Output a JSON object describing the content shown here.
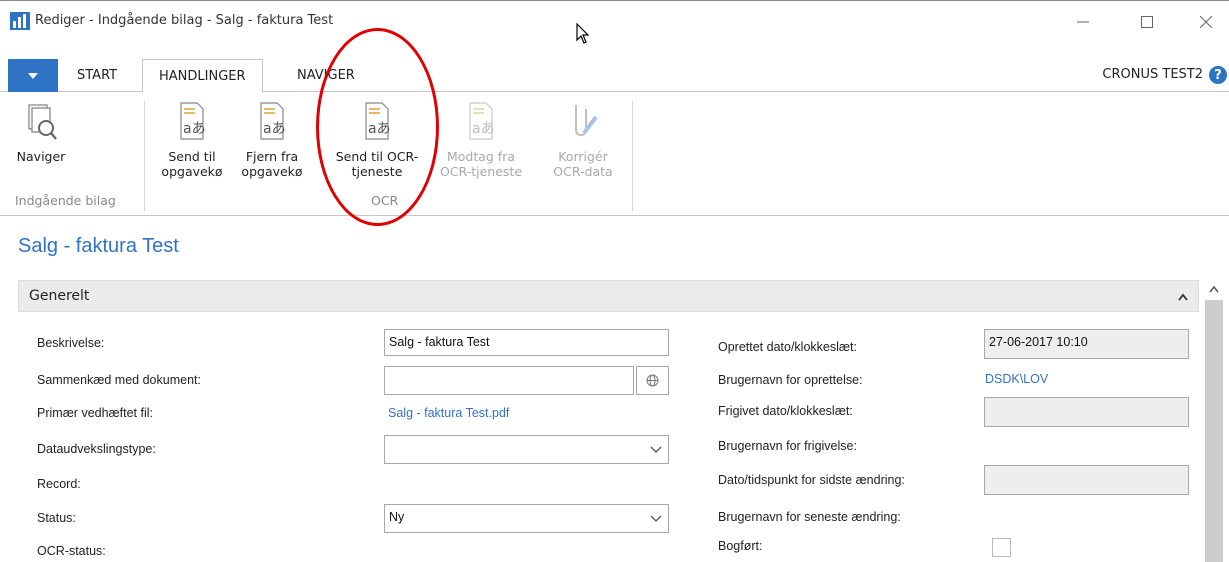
{
  "window": {
    "title": "Rediger - Indgående bilag - Salg - faktura Test",
    "minimize_icon": "minimize-icon",
    "maximize_icon": "maximize-icon",
    "close_icon": "close-icon"
  },
  "ribbon_tabs": {
    "start": "START",
    "handlinger": "HANDLINGER",
    "naviger": "NAVIGER",
    "company": "CRONUS TEST2",
    "help": "?"
  },
  "ribbon": {
    "naviger_btn": "Naviger",
    "send_til_line1": "Send til",
    "send_til_line2": "opgavekø",
    "fjern_fra_line1": "Fjern fra",
    "fjern_fra_line2": "opgavekø",
    "send_ocr_line1": "Send til OCR-",
    "send_ocr_line2": "tjeneste",
    "modtag_line1": "Modtag fra",
    "modtag_line2": "OCR-tjeneste",
    "korriger_line1": "Korrigér",
    "korriger_line2": "OCR-data",
    "group_indgaende": "Indgående bilag",
    "group_ocr": "OCR"
  },
  "page": {
    "title": "Salg - faktura Test",
    "section": "Generelt"
  },
  "form_left": {
    "beskrivelse_label": "Beskrivelse:",
    "beskrivelse_value": "Salg - faktura Test",
    "sammenkaed_label": "Sammenkæd med dokument:",
    "sammenkaed_value": "",
    "primaer_label": "Primær vedhæftet fil:",
    "primaer_value": "Salg - faktura Test.pdf",
    "dataudveksling_label": "Dataudvekslingstype:",
    "dataudveksling_value": "",
    "record_label": "Record:",
    "status_label": "Status:",
    "status_value": "Ny",
    "ocr_status_label": "OCR-status:"
  },
  "form_right": {
    "oprettet_label": "Oprettet dato/klokkeslæt:",
    "oprettet_value": "27-06-2017 10:10",
    "brugernavn_opr_label": "Brugernavn for oprettelse:",
    "brugernavn_opr_value": "DSDK\\LOV",
    "frigivet_label": "Frigivet dato/klokkeslæt:",
    "frigivet_value": "",
    "brugernavn_frig_label": "Brugernavn for frigivelse:",
    "dato_aendring_label": "Dato/tidspunkt for sidste ændring:",
    "dato_aendring_value": "",
    "brugernavn_aendring_label": "Brugernavn for seneste ændring:",
    "bogfort_label": "Bogført:",
    "bogfort_checked": false
  },
  "colors": {
    "accent": "#2e73c4",
    "annotation": "#e00000"
  }
}
